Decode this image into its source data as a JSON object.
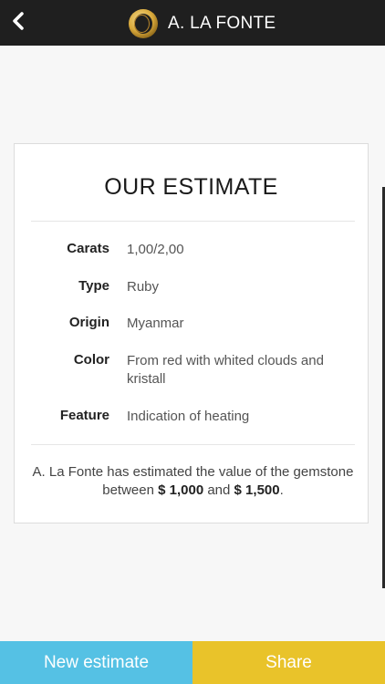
{
  "header": {
    "brand_name": "A. LA FONTE",
    "back_icon": "chevron-left-icon",
    "logo_icon": "gold-ring-logo",
    "background_color": "#1f1f1f",
    "logo_color": "#d9a93b"
  },
  "estimate": {
    "title": "OUR ESTIMATE",
    "details": [
      {
        "label": "Carats",
        "value": "1,00/2,00"
      },
      {
        "label": "Type",
        "value": "Ruby"
      },
      {
        "label": "Origin",
        "value": "Myanmar"
      },
      {
        "label": "Color",
        "value": "From red with whited clouds and kristall"
      },
      {
        "label": "Feature",
        "value": "Indication of heating"
      }
    ],
    "summary_text_1": "A. La Fonte has estimated the value of the gemstone between",
    "min_value": "$ 1,000",
    "summary_and": "and",
    "max_value": "$ 1,500",
    "summary_end": "."
  },
  "actions": {
    "new_estimate_label": "New estimate",
    "share_label": "Share",
    "new_estimate_color": "#55c1e4",
    "share_color": "#e9c32a"
  }
}
